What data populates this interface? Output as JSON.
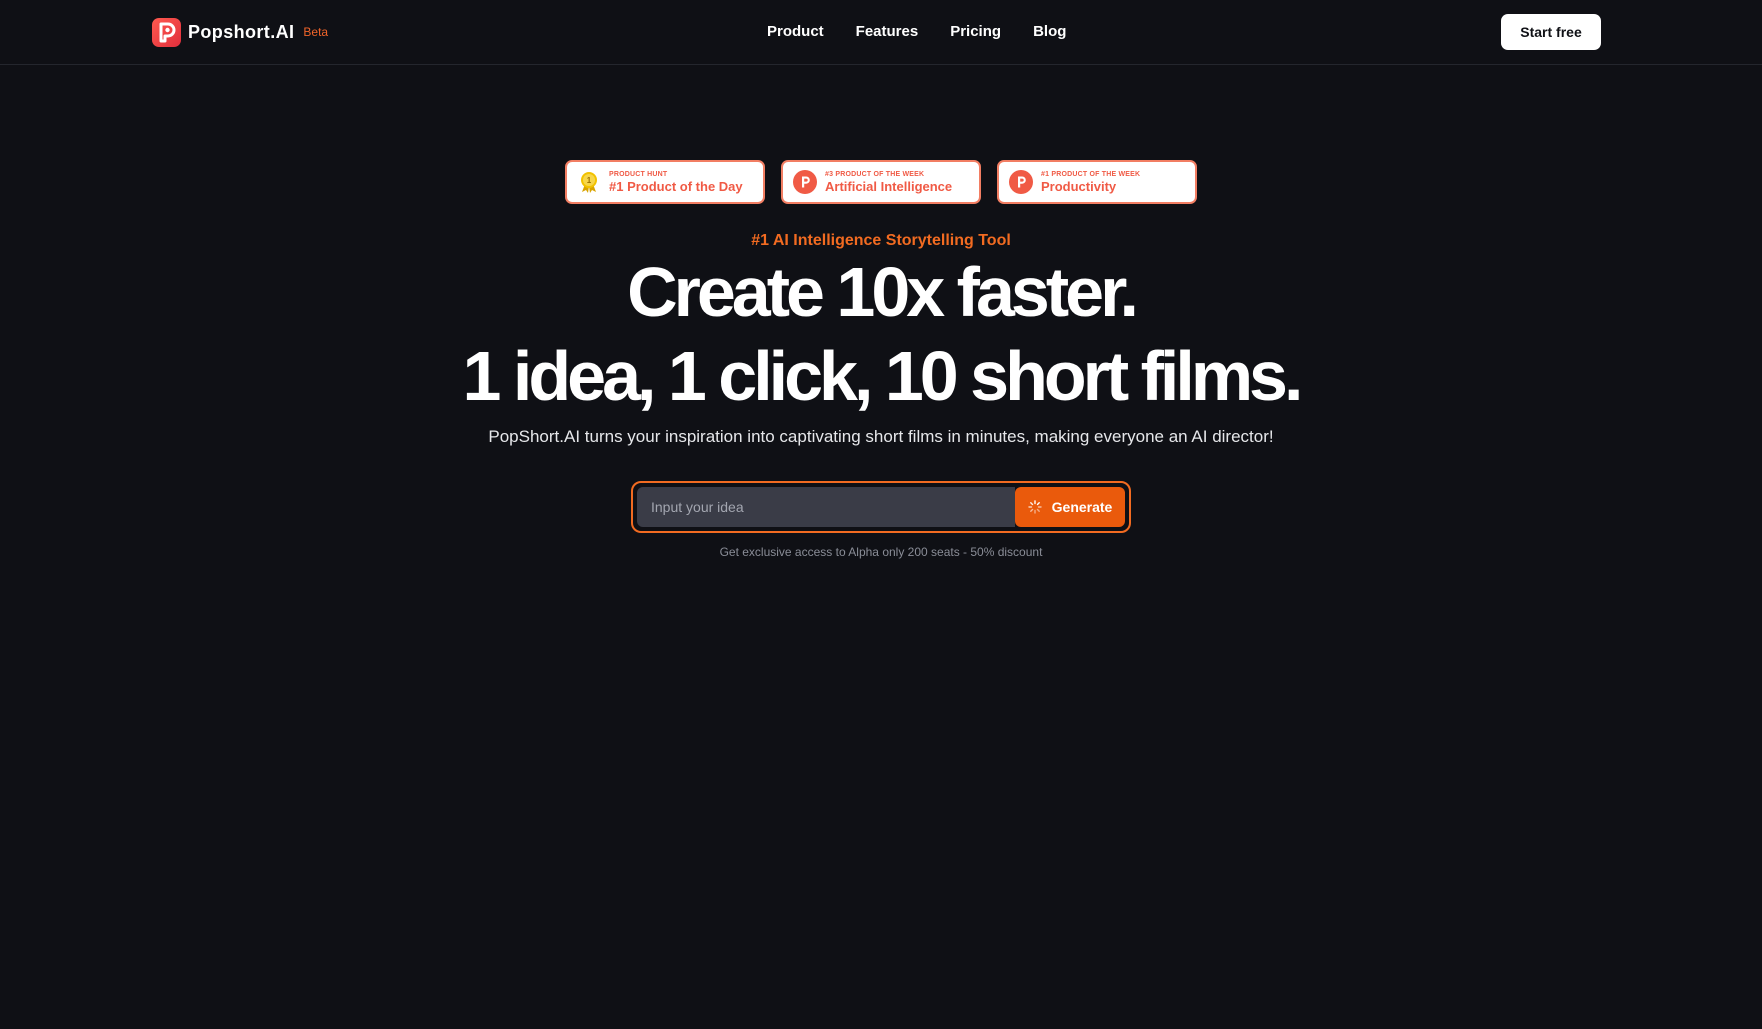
{
  "header": {
    "brand_name": "Popshort.AI",
    "brand_tag": "Beta",
    "nav": [
      "Product",
      "Features",
      "Pricing",
      "Blog"
    ],
    "cta_label": "Start free"
  },
  "badges": [
    {
      "kicker": "PRODUCT HUNT",
      "title": "#1 Product of the Day",
      "icon": "medal-icon"
    },
    {
      "kicker": "#3 PRODUCT OF THE WEEK",
      "title": "Artificial Intelligence",
      "icon": "producthunt-icon"
    },
    {
      "kicker": "#1 PRODUCT OF THE WEEK",
      "title": "Productivity",
      "icon": "producthunt-icon"
    }
  ],
  "hero": {
    "tagline": "#1 AI Intelligence Storytelling Tool",
    "headline_line1": "Create 10x faster.",
    "headline_line2": "1 idea, 1 click, 10 short films.",
    "subtitle": "PopShort.AI turns your inspiration into captivating short films in minutes, making everyone an AI director!"
  },
  "idea_form": {
    "placeholder": "Input your idea",
    "value": "",
    "button_label": "Generate",
    "note": "Get exclusive access to Alpha only 200 seats - 50% discount"
  },
  "colors": {
    "background": "#0f1015",
    "accent": "#f26b21",
    "badge_red": "#f05a45"
  }
}
